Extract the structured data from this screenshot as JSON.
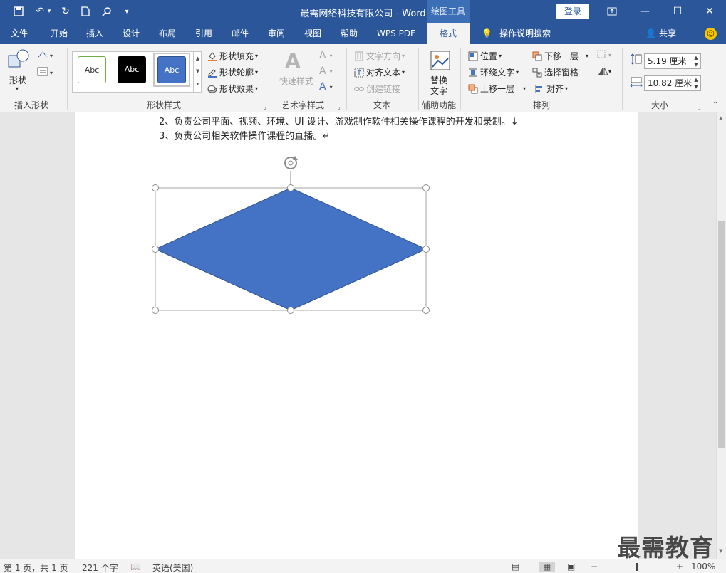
{
  "titlebar": {
    "doc_name": "最需网络科技有限公司  -  Word",
    "drawing_tools": "绘图工具",
    "login": "登录"
  },
  "tabs": [
    {
      "label": "文件"
    },
    {
      "label": "开始"
    },
    {
      "label": "插入"
    },
    {
      "label": "设计"
    },
    {
      "label": "布局"
    },
    {
      "label": "引用"
    },
    {
      "label": "邮件"
    },
    {
      "label": "审阅"
    },
    {
      "label": "视图"
    },
    {
      "label": "帮助"
    },
    {
      "label": "WPS PDF"
    },
    {
      "label": "格式"
    }
  ],
  "tell_me": "操作说明搜索",
  "share": "共享",
  "ribbon": {
    "insert_shapes": {
      "shapes_btn": "形状",
      "label": "插入形状"
    },
    "shape_styles": {
      "samples": [
        "Abc",
        "Abc",
        "Abc"
      ],
      "fill": "形状填充",
      "outline": "形状轮廓",
      "effects": "形状效果",
      "label": "形状样式"
    },
    "wordart": {
      "quick_styles": "快速样式",
      "label": "艺术字样式"
    },
    "text": {
      "direction": "文字方向",
      "align": "对齐文本",
      "link": "创建链接",
      "label": "文本"
    },
    "accessibility": {
      "alt_text_1": "替换",
      "alt_text_2": "文字",
      "label": "辅助功能"
    },
    "arrange": {
      "position": "位置",
      "wrap": "环绕文字",
      "forward": "上移一层",
      "backward": "下移一层",
      "selection_pane": "选择窗格",
      "align": "对齐",
      "label": "排列"
    },
    "size": {
      "height": "5.19 厘米",
      "width": "10.82 厘米",
      "label": "大小"
    }
  },
  "document": {
    "lines": [
      "2、负责公司平面、视频、环境、UI 设计、游戏制作软件相关操作课程的开发和录制。↓",
      "3、负责公司相关软件操作课程的直播。↵"
    ]
  },
  "shape": {
    "fill": "#4472c4",
    "stroke": "#2f528f"
  },
  "status": {
    "page": "第 1 页，共 1 页",
    "words": "221 个字",
    "language": "英语(美国)",
    "zoom": "100%"
  },
  "watermark": "最需教育",
  "colors": {
    "accent": "#2b579a",
    "ribbon": "#f3f3f3"
  }
}
